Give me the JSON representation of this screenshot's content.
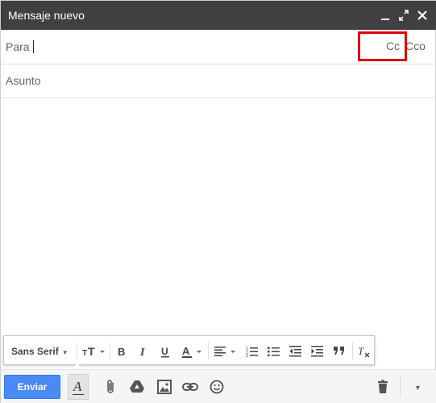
{
  "window": {
    "title": "Mensaje nuevo"
  },
  "titlebar_controls": [
    "minimize-icon",
    "expand-icon",
    "close-icon"
  ],
  "recipients": {
    "label": "Para",
    "value": "",
    "cc_label": "Cc",
    "bcc_label": "Cco"
  },
  "subject": {
    "placeholder": "Asunto",
    "value": ""
  },
  "body": {
    "value": ""
  },
  "format_toolbar": {
    "font_family": "Sans Serif",
    "tools": [
      "font-size-icon",
      "bold-icon",
      "italic-icon",
      "underline-icon",
      "text-color-icon",
      "align-icon",
      "numbered-list-icon",
      "bulleted-list-icon",
      "indent-less-icon",
      "indent-more-icon",
      "quote-icon",
      "remove-formatting-icon"
    ]
  },
  "bottom_bar": {
    "send_label": "Enviar",
    "format_toggle_glyph": "A",
    "tools": [
      "attach-icon",
      "drive-icon",
      "photo-icon",
      "link-icon",
      "emoji-icon",
      "trash-icon",
      "more-options-icon"
    ]
  },
  "colors": {
    "titlebar": "#404040",
    "send_button": "#4a8af4",
    "highlight": "#e00000"
  }
}
